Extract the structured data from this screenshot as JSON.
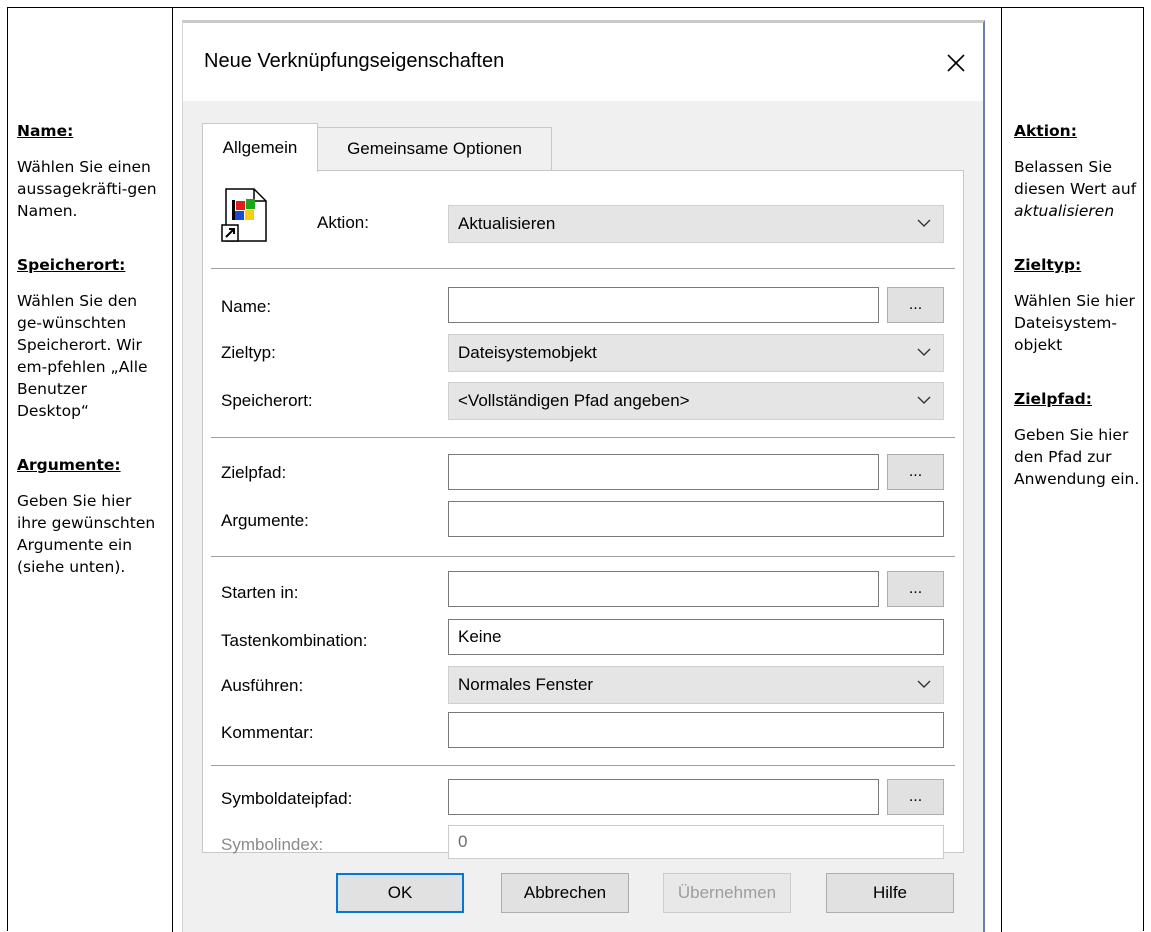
{
  "notes_left": {
    "name_heading": "Name:",
    "name_text": "Wählen Sie einen aussagekräfti-gen Namen.",
    "location_heading": "Speicherort:",
    "location_text": "Wählen Sie den ge-wünschten Speicherort. Wir em-pfehlen „Alle Benutzer Desktop“",
    "args_heading": "Argumente:",
    "args_text": "Geben Sie hier ihre gewünschten Argumente ein (siehe unten)."
  },
  "notes_right": {
    "action_heading": "Aktion:",
    "action_text_1": "Belassen Sie diesen Wert auf",
    "action_text_2": "aktualisieren",
    "targettype_heading": "Zieltyp:",
    "targettype_text": "Wählen Sie hier Dateisystem-objekt",
    "targetpath_heading": "Zielpfad:",
    "targetpath_text": "Geben Sie hier den Pfad zur Anwendung ein."
  },
  "dialog": {
    "title": "Neue Verknüpfungseigenschaften",
    "tabs": [
      "Allgemein",
      "Gemeinsame Optionen"
    ],
    "action": {
      "label": "Aktion:",
      "value": "Aktualisieren"
    },
    "fields": {
      "name": {
        "label": "Name:",
        "value": ""
      },
      "target_type": {
        "label": "Zieltyp:",
        "value": "Dateisystemobjekt"
      },
      "location": {
        "label": "Speicherort:",
        "value": "<Vollständigen Pfad angeben>"
      },
      "target_path": {
        "label": "Zielpfad:",
        "value": ""
      },
      "arguments": {
        "label": "Argumente:",
        "value": ""
      },
      "start_in": {
        "label": "Starten in:",
        "value": ""
      },
      "hotkey": {
        "label": "Tastenkombination:",
        "value": "Keine"
      },
      "run": {
        "label": "Ausführen:",
        "value": "Normales Fenster"
      },
      "comment": {
        "label": "Kommentar:",
        "value": ""
      },
      "icon_path": {
        "label": "Symboldateipfad:",
        "value": ""
      },
      "icon_index": {
        "label": "Symbolindex:",
        "value": "0"
      }
    },
    "browse_label": "...",
    "buttons": {
      "ok": "OK",
      "cancel": "Abbrechen",
      "apply": "Übernehmen",
      "help": "Hilfe"
    },
    "colors": {
      "default_button_border": "#0078d7",
      "window_frame": "#6a7fb0"
    }
  }
}
